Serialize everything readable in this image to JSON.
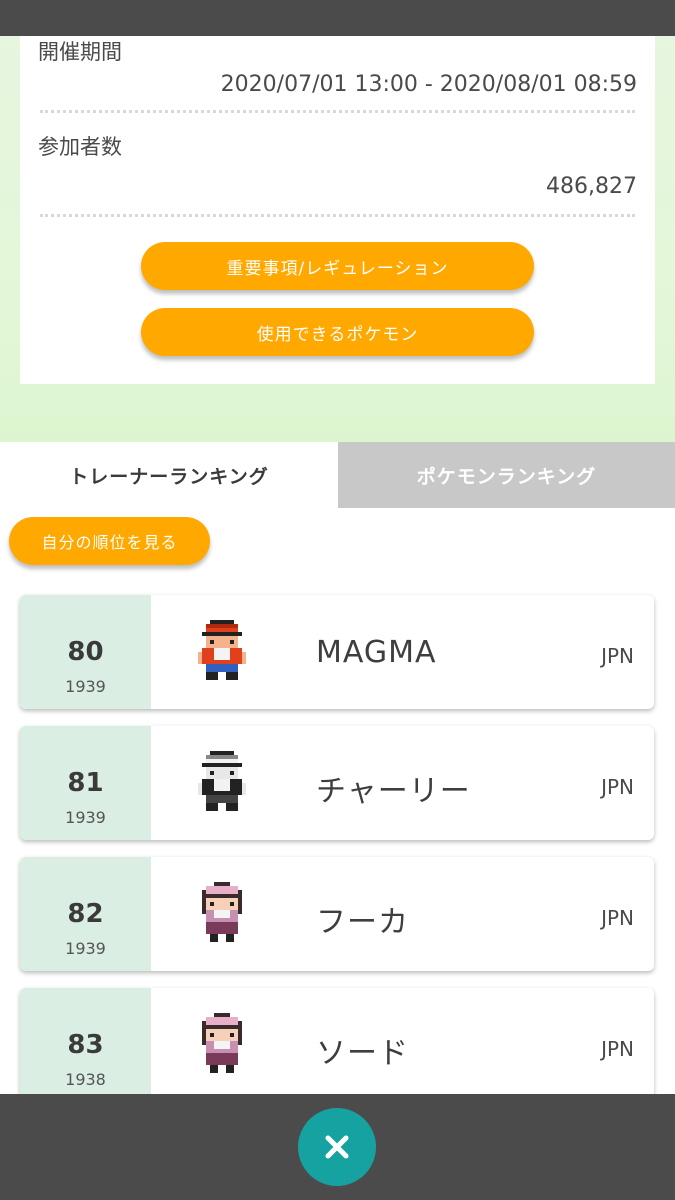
{
  "info": {
    "period_label": "開催期間",
    "period_value": "2020/07/01 13:00 - 2020/08/01 08:59",
    "participants_label": "参加者数",
    "participants_value": "486,827",
    "rules_button": "重要事項/レギュレーション",
    "pokemon_button": "使用できるポケモン"
  },
  "tabs": {
    "trainer": "トレーナーランキング",
    "pokemon": "ポケモンランキング"
  },
  "my_rank_button": "自分の順位を見る",
  "rankings": [
    {
      "rank": "80",
      "rating": "1939",
      "name": "MAGMA",
      "country": "JPN",
      "sprite": "red-cap-trainer-icon"
    },
    {
      "rank": "81",
      "rating": "1939",
      "name": "チャーリー",
      "country": "JPN",
      "sprite": "white-cap-trainer-icon"
    },
    {
      "rank": "82",
      "rating": "1939",
      "name": "フーカ",
      "country": "JPN",
      "sprite": "female-trainer-icon"
    },
    {
      "rank": "83",
      "rating": "1938",
      "name": "ソード",
      "country": "JPN",
      "sprite": "female-trainer-icon"
    }
  ],
  "colors": {
    "accent_orange": "#ffa800",
    "rank_side": "#dbeee4",
    "close_button": "#17a2a2",
    "inactive_tab": "#c8c8c8"
  }
}
